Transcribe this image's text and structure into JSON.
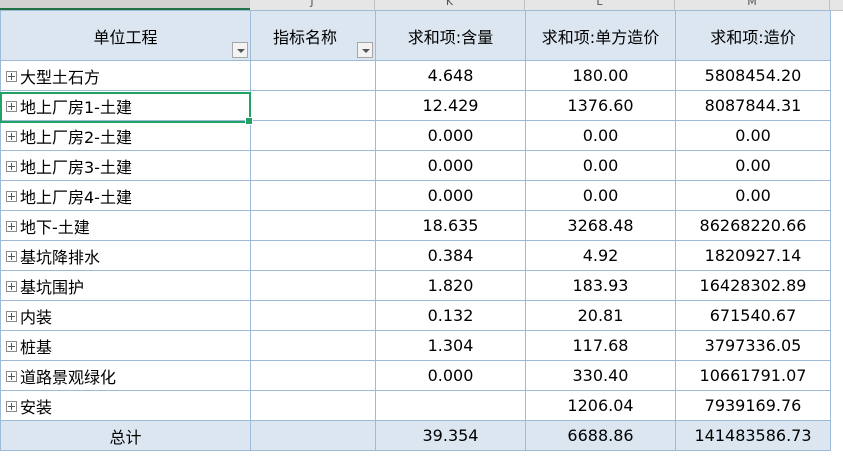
{
  "column_headers": [
    "J",
    "K",
    "L",
    "M"
  ],
  "headers": [
    "单位工程",
    "指标名称",
    "求和项:含量",
    "求和项:单方造价",
    "求和项:造价"
  ],
  "rows": [
    {
      "unit": "大型土石方",
      "content": "4.648",
      "unit_cost": "180.00",
      "cost": "5808454.20"
    },
    {
      "unit": "地上厂房1-土建",
      "content": "12.429",
      "unit_cost": "1376.60",
      "cost": "8087844.31"
    },
    {
      "unit": "地上厂房2-土建",
      "content": "0.000",
      "unit_cost": "0.00",
      "cost": "0.00"
    },
    {
      "unit": "地上厂房3-土建",
      "content": "0.000",
      "unit_cost": "0.00",
      "cost": "0.00"
    },
    {
      "unit": "地上厂房4-土建",
      "content": "0.000",
      "unit_cost": "0.00",
      "cost": "0.00"
    },
    {
      "unit": "地下-土建",
      "content": "18.635",
      "unit_cost": "3268.48",
      "cost": "86268220.66"
    },
    {
      "unit": "基坑降排水",
      "content": "0.384",
      "unit_cost": "4.92",
      "cost": "1820927.14"
    },
    {
      "unit": "基坑围护",
      "content": "1.820",
      "unit_cost": "183.93",
      "cost": "16428302.89"
    },
    {
      "unit": "内装",
      "content": "0.132",
      "unit_cost": "20.81",
      "cost": "671540.67"
    },
    {
      "unit": "桩基",
      "content": "1.304",
      "unit_cost": "117.68",
      "cost": "3797336.05"
    },
    {
      "unit": "道路景观绿化",
      "content": "0.000",
      "unit_cost": "330.40",
      "cost": "10661791.07"
    },
    {
      "unit": "安装",
      "content": "",
      "unit_cost": "1206.04",
      "cost": "7939169.76"
    }
  ],
  "total": {
    "label": "总计",
    "content": "39.354",
    "unit_cost": "6688.86",
    "cost": "141483586.73"
  },
  "colors": {
    "header_bg": "#dce6f1",
    "grid": "#9dbbd6",
    "selection": "#21a366"
  }
}
